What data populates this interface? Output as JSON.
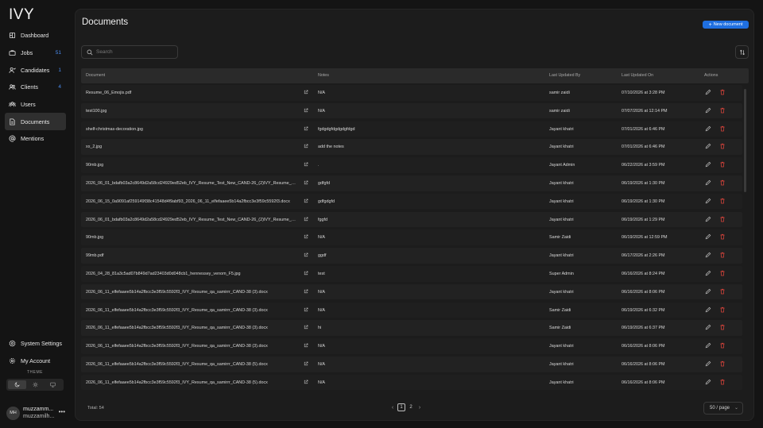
{
  "app": {
    "logo": "IVY"
  },
  "sidebar": {
    "items": [
      {
        "label": "Dashboard",
        "icon": "dashboard-icon",
        "count": ""
      },
      {
        "label": "Jobs",
        "icon": "briefcase-icon",
        "count": "51"
      },
      {
        "label": "Candidates",
        "icon": "candidates-icon",
        "count": "1"
      },
      {
        "label": "Clients",
        "icon": "clients-icon",
        "count": "4"
      },
      {
        "label": "Users",
        "icon": "users-icon",
        "count": ""
      },
      {
        "label": "Documents",
        "icon": "document-icon",
        "count": "",
        "active": true
      },
      {
        "label": "Mentions",
        "icon": "at-icon",
        "count": ""
      }
    ],
    "bottom_items": [
      {
        "label": "System Settings",
        "icon": "settings-icon"
      },
      {
        "label": "My Account",
        "icon": "gear-icon"
      }
    ],
    "theme_label": "THEME",
    "theme_selected": "dark",
    "user": {
      "initials": "MH",
      "name": "muzzamm...",
      "email": "muzzamilh..."
    }
  },
  "page": {
    "title": "Documents",
    "new_button": "New document",
    "search_placeholder": "Search"
  },
  "table": {
    "columns": [
      "Document",
      "Notes",
      "Last Updated By",
      "Last Updated On",
      "Actions"
    ],
    "rows": [
      {
        "document": "Resume_06_Emojis.pdf",
        "notes": "N/A",
        "by": "samir zaidi",
        "on": "07/10/2026 at 3:28 PM"
      },
      {
        "document": "test100.jpg",
        "notes": "N/A",
        "by": "samir zaidi",
        "on": "07/07/2026 at 12:14 PM"
      },
      {
        "document": "shelf-christmas-decoration.jpg",
        "notes": "fgdgdgfdgdgdgfdgd",
        "by": "Jayant khatri",
        "on": "07/01/2026 at 6:46 PM"
      },
      {
        "document": "xx_2.jpg",
        "notes": "add the notes",
        "by": "Jayant khatri",
        "on": "07/01/2026 at 6:46 PM"
      },
      {
        "document": "90mb.jpg",
        "notes": ".",
        "by": "Jayant Admin",
        "on": "06/22/2026 at 3:59 PM"
      },
      {
        "document": "2026_06_01_bdafb03a2c8649d2a58cd24929ed52eb_IVY_Resume_Test_New_CAND-26_(2)IVY_Resume_Test_New.pdf",
        "notes": "gdfgfd",
        "by": "Jayant khatri",
        "on": "06/19/2026 at 1:30 PM"
      },
      {
        "document": "2026_06_15_0a9091af259149f38c41548d4f9abf93_2026_06_11_elfefaaee5b14a2fbcc3e3f59c5592f3.docx",
        "notes": "gdfgdgfd",
        "by": "Jayant khatri",
        "on": "06/19/2026 at 1:30 PM"
      },
      {
        "document": "2026_06_01_bdafb03a2c8649d2a58cd24929ed52eb_IVY_Resume_Test_New_CAND-26_(2)IVY_Resume_Test_New.pdf",
        "notes": "fggfd",
        "by": "Jayant khatri",
        "on": "06/19/2026 at 1:29 PM"
      },
      {
        "document": "90mb.jpg",
        "notes": "N/A",
        "by": "Samir Zaidi",
        "on": "06/19/2026 at 12:59 PM"
      },
      {
        "document": "99mb.pdf",
        "notes": "ggdf",
        "by": "Jayant khatri",
        "on": "06/17/2026 at 2:26 PM"
      },
      {
        "document": "2026_04_28_81a3c5ad07b849d7ad23403d0d048cb1_hennessey_venom_F5.jpg",
        "notes": "test",
        "by": "Super Admin",
        "on": "06/16/2026 at 8:24 PM"
      },
      {
        "document": "2026_06_11_elfefaaee5b14a2fbcc3e3f59c5592f3_IVY_Resume_qa_samirrr_CAND-38 (3).docx",
        "notes": "N/A",
        "by": "Jayant khatri",
        "on": "06/16/2026 at 8:06 PM"
      },
      {
        "document": "2026_06_11_elfefaaee5b14a2fbcc3e3f59c5592f3_IVY_Resume_qa_samirrr_CAND-38 (3).docx",
        "notes": "N/A",
        "by": "Samir Zaidi",
        "on": "06/19/2026 at 6:32 PM"
      },
      {
        "document": "2026_06_11_elfefaaee5b14a2fbcc3e3f59c5592f3_IVY_Resume_qa_samirrr_CAND-38 (3).docx",
        "notes": "hi",
        "by": "Samir Zaidi",
        "on": "06/19/2026 at 6:37 PM"
      },
      {
        "document": "2026_06_11_elfefaaee5b14a2fbcc3e3f59c5592f3_IVY_Resume_qa_samirrr_CAND-38 (3).docx",
        "notes": "N/A",
        "by": "Jayant khatri",
        "on": "06/16/2026 at 8:06 PM"
      },
      {
        "document": "2026_06_11_elfefaaee5b14a2fbcc3e3f59c5592f3_IVY_Resume_qa_samirrr_CAND-38 (5).docx",
        "notes": "N/A",
        "by": "Jayant khatri",
        "on": "06/16/2026 at 8:06 PM"
      },
      {
        "document": "2026_06_11_elfefaaee5b14a2fbcc3e3f59c5592f3_IVY_Resume_qa_samirrr_CAND-38 (5).docx",
        "notes": "N/A",
        "by": "Jayant khatri",
        "on": "06/16/2026 at 8:06 PM"
      }
    ]
  },
  "footer": {
    "total": "Total: 54",
    "pages": [
      "1",
      "2"
    ],
    "current_page": "1",
    "per_page": "50 / page"
  },
  "colors": {
    "accent": "#1f6fe0",
    "count": "#4a8cf0",
    "delete": "#e0453c"
  }
}
